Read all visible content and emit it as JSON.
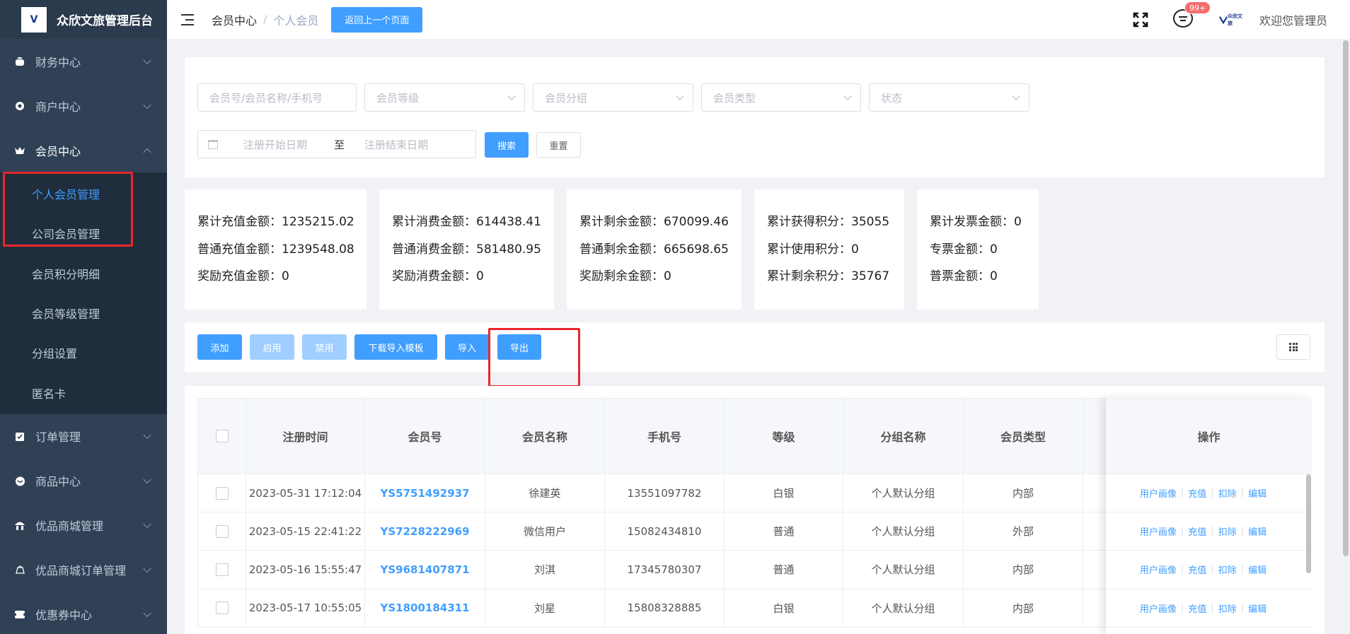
{
  "app": {
    "title": "众欣文旅管理后台",
    "logo_text": "V"
  },
  "sidebar": {
    "items": [
      {
        "label": "财务中心",
        "icon": "wallet-icon"
      },
      {
        "label": "商户中心",
        "icon": "store-icon"
      },
      {
        "label": "会员中心",
        "icon": "crown-icon",
        "expanded": true,
        "children": [
          {
            "label": "个人会员管理",
            "active": true
          },
          {
            "label": "公司会员管理"
          },
          {
            "label": "会员积分明细"
          },
          {
            "label": "会员等级管理"
          },
          {
            "label": "分组设置"
          },
          {
            "label": "匿名卡"
          }
        ]
      },
      {
        "label": "订单管理",
        "icon": "clipboard-icon"
      },
      {
        "label": "商品中心",
        "icon": "goods-icon"
      },
      {
        "label": "优品商城管理",
        "icon": "mall-icon"
      },
      {
        "label": "优品商城订单管理",
        "icon": "mall-order-icon"
      },
      {
        "label": "优惠券中心",
        "icon": "coupon-icon"
      }
    ]
  },
  "header": {
    "breadcrumb": [
      "会员中心",
      "个人会员"
    ],
    "back_button": "返回上一个页面",
    "message_badge": "99+",
    "brand_small": "众欣文旅",
    "welcome": "欢迎您管理员"
  },
  "filters": {
    "keyword_placeholder": "会员号/会员名称/手机号",
    "level_placeholder": "会员等级",
    "group_placeholder": "会员分组",
    "type_placeholder": "会员类型",
    "status_placeholder": "状态",
    "start_date_placeholder": "注册开始日期",
    "date_separator": "至",
    "end_date_placeholder": "注册结束日期",
    "search_button": "搜索",
    "reset_button": "重置"
  },
  "stats": [
    [
      "累计充值金额：1235215.02",
      "普通充值金额：1239548.08",
      "奖励充值金额：0"
    ],
    [
      "累计消费金额：614438.41",
      "普通消费金额：581480.95",
      "奖励消费金额：0"
    ],
    [
      "累计剩余金额：670099.46",
      "普通剩余金额：665698.65",
      "奖励剩余金额：0"
    ],
    [
      "累计获得积分：35055",
      "累计使用积分：0",
      "累计剩余积分：35767"
    ],
    [
      "累计发票金额：0",
      "专票金额：0",
      "普票金额：0"
    ]
  ],
  "toolbar": {
    "add": "添加",
    "enable": "启用",
    "disable": "禁用",
    "download_template": "下载导入模板",
    "import": "导入",
    "export": "导出"
  },
  "table": {
    "columns": [
      "注册时间",
      "会员号",
      "会员名称",
      "手机号",
      "等级",
      "分组名称",
      "会员类型"
    ],
    "action_column": "操作",
    "actions": [
      "用户画像",
      "充值",
      "扣除",
      "编辑"
    ],
    "rows": [
      [
        "2023-05-31 17:12:04",
        "YS5751492937",
        "徐建英",
        "13551097782",
        "白银",
        "个人默认分组",
        "内部"
      ],
      [
        "2023-05-15 22:41:22",
        "YS7228222969",
        "微信用户",
        "15082434810",
        "普通",
        "个人默认分组",
        "外部"
      ],
      [
        "2023-05-16 15:55:47",
        "YS9681407871",
        "刘淇",
        "17345780307",
        "普通",
        "个人默认分组",
        "内部"
      ],
      [
        "2023-05-17 10:55:05",
        "YS1800184311",
        "刘星",
        "15808328885",
        "白银",
        "个人默认分组",
        "内部"
      ]
    ]
  },
  "colors": {
    "sidebar_bg": "#304156",
    "primary": "#409eff",
    "highlight_box": "#e8262c"
  }
}
